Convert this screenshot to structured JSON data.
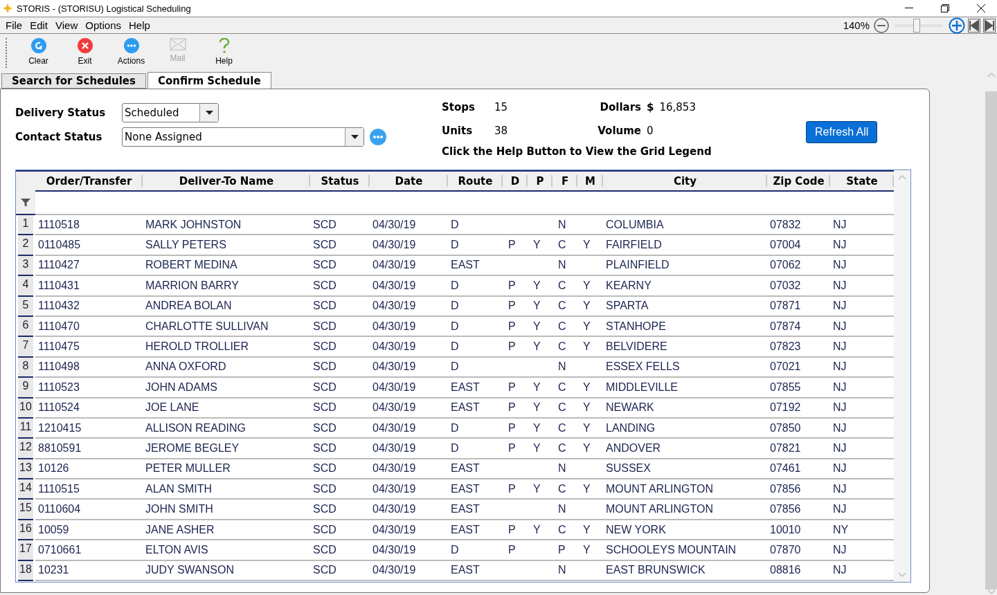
{
  "window": {
    "title": "STORIS - (STORISU) Logistical Scheduling"
  },
  "menu": [
    "File",
    "Edit",
    "View",
    "Options",
    "Help"
  ],
  "zoom": {
    "reading": "140%",
    "level": 0.45
  },
  "toolbar": [
    {
      "kind": "clear",
      "label": "Clear",
      "disabled": false
    },
    {
      "kind": "exit",
      "label": "Exit",
      "disabled": false
    },
    {
      "kind": "actions",
      "label": "Actions",
      "disabled": false
    },
    {
      "kind": "mail",
      "label": "Mail",
      "disabled": true
    },
    {
      "kind": "help",
      "label": "Help",
      "disabled": false
    }
  ],
  "tabs": [
    {
      "label": "Search for Schedules",
      "selected": false
    },
    {
      "label": "Confirm Schedule",
      "selected": true
    }
  ],
  "filters": [
    {
      "label": "Delivery Status",
      "value": "Scheduled",
      "wide": false,
      "more": false
    },
    {
      "label": "Contact Status",
      "value": "None Assigned",
      "wide": true,
      "more": true
    }
  ],
  "totals": [
    {
      "label": "Stops",
      "value": "15"
    },
    {
      "label": "Dollars",
      "prefix": "$",
      "value": "16,853"
    },
    {
      "label": "Units",
      "value": "38"
    },
    {
      "label": "Volume",
      "value": "0"
    }
  ],
  "hint": "Click the Help Button to View the Grid Legend",
  "refresh_button": "Refresh All",
  "table": {
    "columns": [
      "",
      "Order/Transfer",
      "Deliver-To Name",
      "Status",
      "Date",
      "Route",
      "D",
      "P",
      "F",
      "M",
      "City",
      "Zip Code",
      "State"
    ],
    "rows": [
      [
        "1",
        "1110518",
        "MARK JOHNSTON",
        "SCD",
        "04/30/19",
        "D",
        "",
        "",
        "N",
        "",
        "COLUMBIA",
        "07832",
        "NJ"
      ],
      [
        "2",
        "0110485",
        "SALLY PETERS",
        "SCD",
        "04/30/19",
        "D",
        "P",
        "Y",
        "C",
        "Y",
        "FAIRFIELD",
        "07004",
        "NJ"
      ],
      [
        "3",
        "1110427",
        "ROBERT MEDINA",
        "SCD",
        "04/30/19",
        "EAST",
        "",
        "",
        "N",
        "",
        "PLAINFIELD",
        "07062",
        "NJ"
      ],
      [
        "4",
        "1110431",
        "MARRION BARRY",
        "SCD",
        "04/30/19",
        "D",
        "P",
        "Y",
        "C",
        "Y",
        "KEARNY",
        "07032",
        "NJ"
      ],
      [
        "5",
        "1110432",
        "ANDREA BOLAN",
        "SCD",
        "04/30/19",
        "D",
        "P",
        "Y",
        "C",
        "Y",
        "SPARTA",
        "07871",
        "NJ"
      ],
      [
        "6",
        "1110470",
        "CHARLOTTE SULLIVAN",
        "SCD",
        "04/30/19",
        "D",
        "P",
        "Y",
        "C",
        "Y",
        "STANHOPE",
        "07874",
        "NJ"
      ],
      [
        "7",
        "1110475",
        "HEROLD TROLLIER",
        "SCD",
        "04/30/19",
        "D",
        "P",
        "Y",
        "C",
        "Y",
        "BELVIDERE",
        "07823",
        "NJ"
      ],
      [
        "8",
        "1110498",
        "ANNA OXFORD",
        "SCD",
        "04/30/19",
        "D",
        "",
        "",
        "N",
        "",
        "ESSEX FELLS",
        "07021",
        "NJ"
      ],
      [
        "9",
        "1110523",
        "JOHN ADAMS",
        "SCD",
        "04/30/19",
        "EAST",
        "P",
        "Y",
        "C",
        "Y",
        "MIDDLEVILLE",
        "07855",
        "NJ"
      ],
      [
        "10",
        "1110524",
        "JOE LANE",
        "SCD",
        "04/30/19",
        "EAST",
        "P",
        "Y",
        "C",
        "Y",
        "NEWARK",
        "07192",
        "NJ"
      ],
      [
        "11",
        "1210415",
        "ALLISON READING",
        "SCD",
        "04/30/19",
        "D",
        "P",
        "Y",
        "C",
        "Y",
        "LANDING",
        "07850",
        "NJ"
      ],
      [
        "12",
        "8810591",
        "JEROME BEGLEY",
        "SCD",
        "04/30/19",
        "D",
        "P",
        "Y",
        "C",
        "Y",
        "ANDOVER",
        "07821",
        "NJ"
      ],
      [
        "13",
        "10126",
        "PETER MULLER",
        "SCD",
        "04/30/19",
        "EAST",
        "",
        "",
        "N",
        "",
        "SUSSEX",
        "07461",
        "NJ"
      ],
      [
        "14",
        "1110515",
        "ALAN SMITH",
        "SCD",
        "04/30/19",
        "EAST",
        "P",
        "Y",
        "C",
        "Y",
        "MOUNT ARLINGTON",
        "07856",
        "NJ"
      ],
      [
        "15",
        "0110604",
        "JOHN SMITH",
        "SCD",
        "04/30/19",
        "EAST",
        "",
        "",
        "N",
        "",
        "MOUNT ARLINGTON",
        "07856",
        "NJ"
      ],
      [
        "16",
        "10059",
        "JANE ASHER",
        "SCD",
        "04/30/19",
        "EAST",
        "P",
        "Y",
        "C",
        "Y",
        "NEW YORK",
        "10010",
        "NY"
      ],
      [
        "17",
        "0710661",
        "ELTON AVIS",
        "SCD",
        "04/30/19",
        "D",
        "P",
        "",
        "P",
        "Y",
        "SCHOOLEYS MOUNTAIN",
        "07870",
        "NJ"
      ],
      [
        "18",
        "10231",
        "JUDY SWANSON",
        "SCD",
        "04/30/19",
        "EAST",
        "",
        "",
        "N",
        "",
        "EAST BRUNSWICK",
        "08816",
        "NJ"
      ]
    ]
  }
}
